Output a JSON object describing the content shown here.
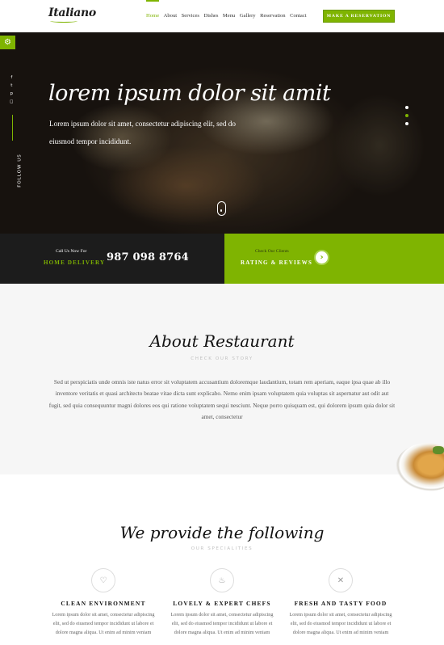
{
  "header": {
    "logo": "Italiano",
    "nav": [
      "Home",
      "About",
      "Services",
      "Dishes",
      "Menu",
      "Gallery",
      "Reservation",
      "Contact"
    ],
    "cta": "MAKE A RESERVATION"
  },
  "hero": {
    "title": "lorem ipsum dolor sit amit",
    "subtitle": "Lorem ipsum dolor sit amet, consectetur adipiscing elit, sed do eiusmod tempor incididunt.",
    "follow": "FOLLOW US",
    "social_icons": [
      "facebook-icon",
      "twitter-icon",
      "pinterest-icon",
      "instagram-icon"
    ],
    "slides": 3,
    "active_slide": 2
  },
  "delivery": {
    "small": "Call Us Now For",
    "label": "HOME DELIVERY",
    "phone": "987 098 8764"
  },
  "rating": {
    "small": "Check Our Clients",
    "label": "RATING & REVIEWS"
  },
  "about": {
    "title": "About Restaurant",
    "subtitle": "CHECK OUR STORY",
    "text": "Sed ut perspiciatis unde omnis iste natus error sit voluptatem accusantium doloremque laudantium, totam rem aperiam, eaque ipsa quae ab illo inventore veritatis et quasi architecto beatae vitae dicta sunt explicabo. Nemo enim ipsam voluptatem quia voluptas sit aspernatur aut odit aut fugit, sed quia consequuntur magni dolores eos qui ratione voluptatem sequi nesciunt. Neque porro quisquam est, qui dolorem ipsum quia dolor sit amet, consectetur"
  },
  "services": {
    "title": "We provide the following",
    "subtitle": "OUR SPECIALITIES",
    "items": [
      {
        "title": "CLEAN ENVIRONMENT",
        "text": "Lorem ipsum dolor sit amet, consectetur adipiscing elit, sed do eiusmod tempor incididunt ut labore et dolore magna aliqua. Ut enim ad minim veniam",
        "icon": "heart-icon"
      },
      {
        "title": "LOVELY & EXPERT CHEFS",
        "text": "Lorem ipsum dolor sit amet, consectetur adipiscing elit, sed do eiusmod tempor incididunt ut labore et dolore magna aliqua. Ut enim ad minim veniam",
        "icon": "chef-hat-icon"
      },
      {
        "title": "FRESH AND TASTY FOOD",
        "text": "Lorem ipsum dolor sit amet, consectetur adipiscing elit, sed do eiusmod tempor incididunt ut labore et dolore magna aliqua. Ut enim ad minim veniam",
        "icon": "cutlery-icon"
      }
    ]
  },
  "colors": {
    "accent": "#7fb401",
    "dark": "#1c1c1c"
  }
}
